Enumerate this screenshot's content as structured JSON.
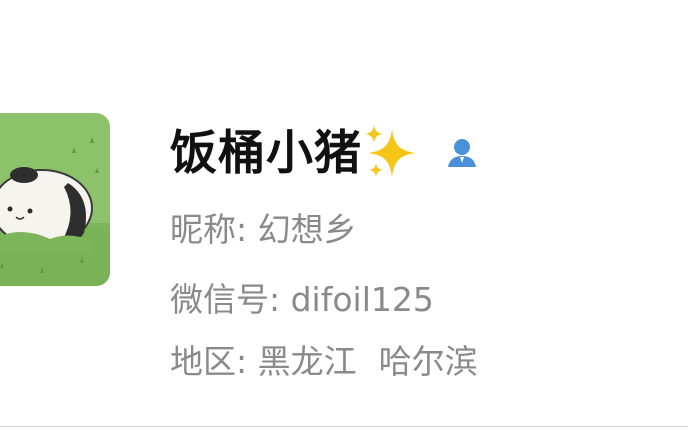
{
  "profile": {
    "display_name": "饭桶小猪",
    "name_emoji_icon": "sparkles-icon",
    "contact_icon": "person-contact-icon",
    "nickname_label": "昵称: ",
    "nickname_value": "幻想乡",
    "wechat_id_label": "微信号: ",
    "wechat_id_value": "difoil125",
    "region_label": "地区: ",
    "region_province": "黑龙江",
    "region_city": "哈尔滨"
  },
  "colors": {
    "name_text": "#111111",
    "info_text": "#8a8a8a",
    "avatar_bg": "#8cc26a",
    "sparkle": "#f5c518",
    "contact_icon": "#4a90d9"
  }
}
